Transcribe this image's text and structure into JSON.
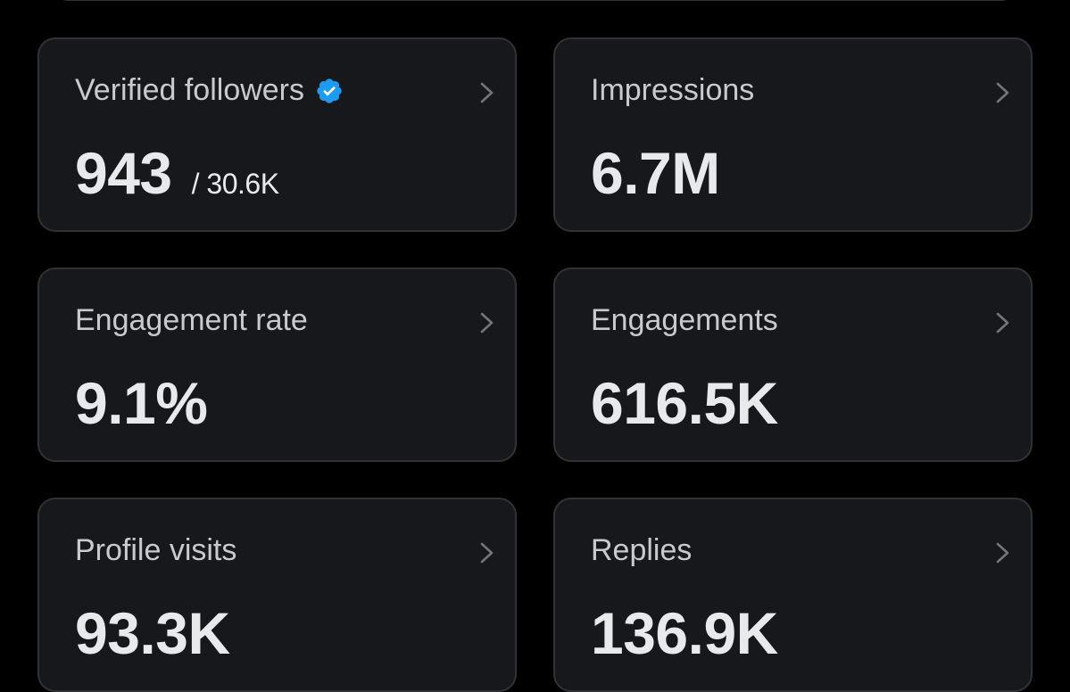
{
  "cards": [
    {
      "label": "Verified followers",
      "value": "943",
      "subvalue": "/ 30.6K",
      "icon": "verified-badge-icon",
      "icon_color": "#1d9bf0"
    },
    {
      "label": "Impressions",
      "value": "6.7M"
    },
    {
      "label": "Engagement rate",
      "value": "9.1%"
    },
    {
      "label": "Engagements",
      "value": "616.5K"
    },
    {
      "label": "Profile visits",
      "value": "93.3K"
    },
    {
      "label": "Replies",
      "value": "136.9K"
    }
  ],
  "icons": {
    "card_arrow": "chevron-right-icon"
  },
  "colors": {
    "background": "#000000",
    "card_background": "#16181c",
    "card_border": "#2f3336",
    "verified_blue": "#1d9bf0"
  }
}
